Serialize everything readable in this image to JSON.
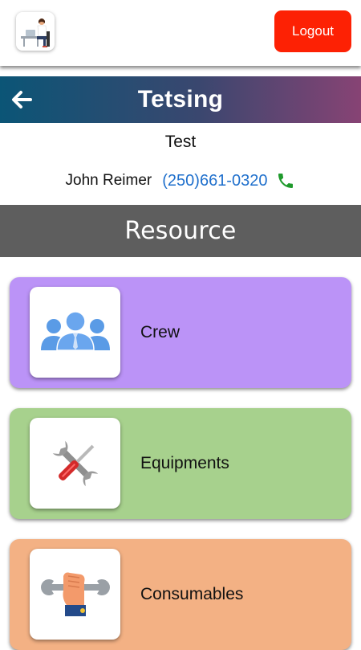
{
  "header": {
    "logo_icon": "person-at-laptop-logo",
    "logout_label": "Logout",
    "logout_color": "#fd2104"
  },
  "titlebar": {
    "back_icon": "arrow-left-icon",
    "title": "Tetsing",
    "gradient": [
      "#0b5576",
      "#874374"
    ]
  },
  "project": {
    "name": "Test",
    "contact_name": "John Reimer",
    "phone": "(250)661-0320",
    "phone_icon": "phone-icon",
    "phone_color": "#1e6fcc"
  },
  "section": {
    "title": "Resource",
    "background": "#5e5e5e"
  },
  "resources": [
    {
      "label": "Crew",
      "icon": "crew-group-icon",
      "color": "#bb93f7"
    },
    {
      "label": "Equipments",
      "icon": "wrench-screwdriver-icon",
      "color": "#a7d18d"
    },
    {
      "label": "Consumables",
      "icon": "hand-wrench-icon",
      "color": "#f3b184"
    }
  ]
}
